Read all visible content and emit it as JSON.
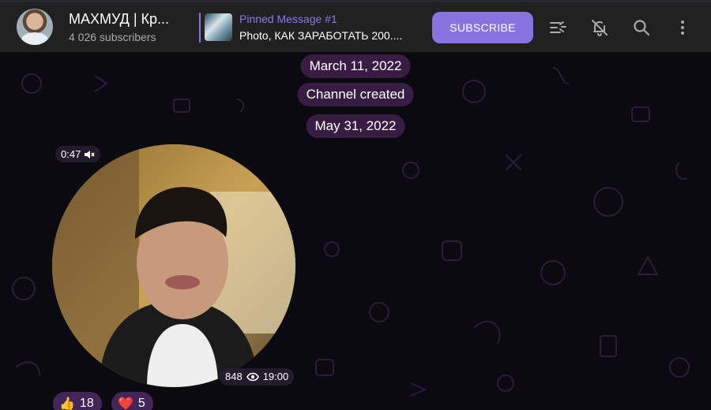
{
  "header": {
    "channel_name": "МАХМУД | Кр...",
    "subscribers": "4 026 subscribers",
    "pinned_title": "Pinned Message #1",
    "pinned_text": "Photo, КАК ЗАРАБОТАТЬ 200....",
    "subscribe_label": "SUBSCRIBE",
    "icons": [
      "voice-chat-icon",
      "mute-bell-icon",
      "search-icon",
      "more-vertical-icon"
    ]
  },
  "chat": {
    "service_messages": [
      "March 11, 2022",
      "Channel created",
      "May 31, 2022"
    ],
    "video_message": {
      "duration": "0:47",
      "views": "848",
      "time": "19:00"
    },
    "reactions": [
      {
        "emoji": "👍",
        "count": "18"
      },
      {
        "emoji": "❤️",
        "count": "5"
      }
    ]
  },
  "colors": {
    "accent": "#8774e1",
    "header_bg": "#212121",
    "pill_bg": "#3e1e48",
    "chat_bg": "#0b0a10"
  }
}
